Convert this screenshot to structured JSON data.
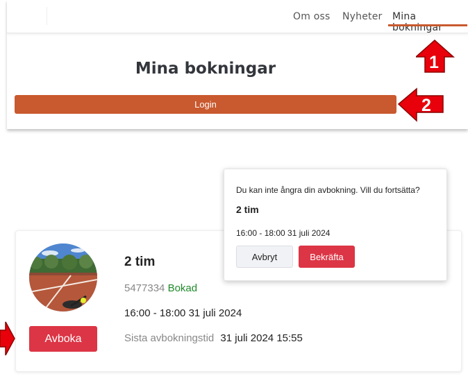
{
  "nav": {
    "items": [
      {
        "label": "Om oss"
      },
      {
        "label": "Nyheter"
      },
      {
        "label": "Mina bokningar",
        "active": true
      }
    ]
  },
  "page": {
    "title": "Mina bokningar",
    "login_label": "Login"
  },
  "annotations": {
    "badge1": "1",
    "badge2": "2"
  },
  "booking": {
    "duration": "2 tim",
    "id": "5477334",
    "status": "Bokad",
    "time": "16:00 - 18:00 31 juli 2024",
    "deadline_label": "Sista avbokningstid",
    "deadline_value": "31 juli 2024 15:55",
    "cancel_label": "Avboka"
  },
  "confirm": {
    "message": "Du kan inte ångra din avbokning. Vill du fortsätta?",
    "title": "2 tim",
    "time": "16:00 - 18:00 31 juli 2024",
    "cancel_label": "Avbryt",
    "confirm_label": "Bekräfta"
  },
  "colors": {
    "accent": "#c9592e",
    "danger": "#dc3545",
    "status_green": "#1f8a2a",
    "annotation_red": "#e8000b"
  },
  "icons": {
    "arrow": "red-arrow-icon"
  }
}
